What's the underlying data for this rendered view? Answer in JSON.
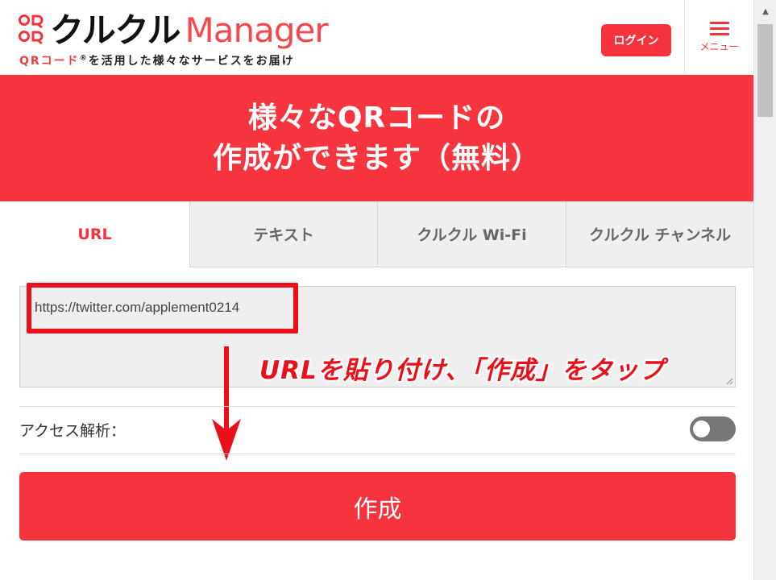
{
  "header": {
    "logo_name": "クルクル",
    "logo_manager": "Manager",
    "tagline_prefix": "QRコード",
    "tagline_mark": "®",
    "tagline_rest": "を活用した様々なサービスをお届け",
    "login_label": "ログイン",
    "menu_label": "メニュー"
  },
  "hero": {
    "line1": "様々なQRコードの",
    "line2": "作成ができます（無料）"
  },
  "tabs": [
    {
      "label": "URL",
      "active": true
    },
    {
      "label": "テキスト",
      "active": false
    },
    {
      "label": "クルクル Wi-Fi",
      "active": false
    },
    {
      "label": "クルクル チャンネル",
      "active": false
    }
  ],
  "form": {
    "url_value": "https://twitter.com/applement0214",
    "analysis_label": "アクセス解析：",
    "analysis_enabled": false,
    "create_label": "作成"
  },
  "annotation": {
    "text": "URLを貼り付け、「作成」をタップ",
    "color": "#ea0f19"
  },
  "colors": {
    "brand_red": "#f5333d",
    "hero_bg": "#f7353e"
  }
}
